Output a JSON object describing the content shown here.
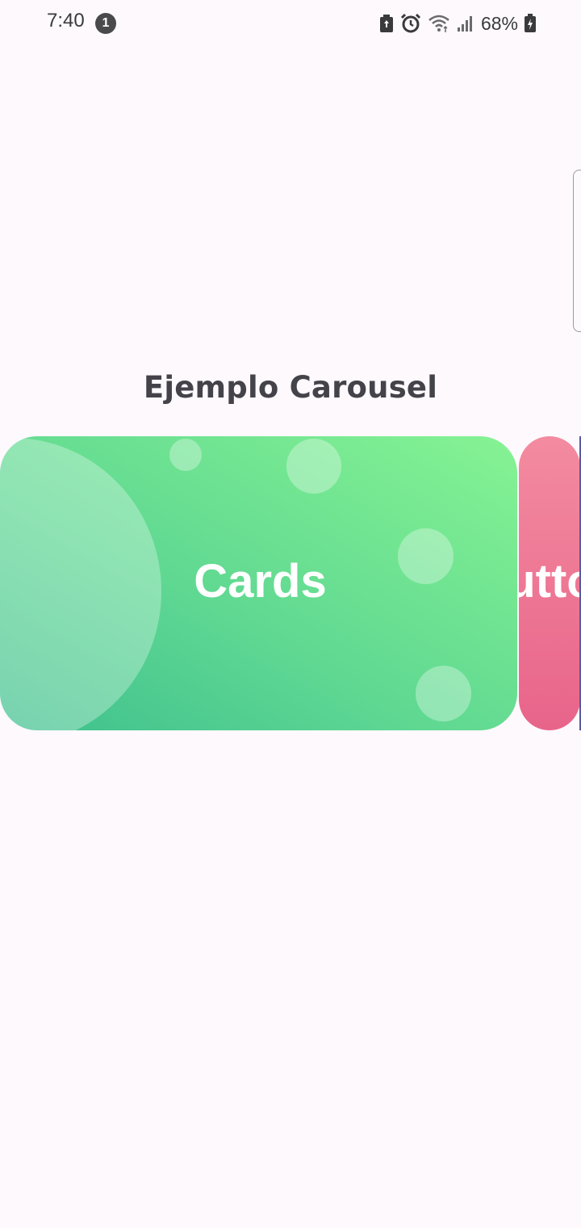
{
  "status_bar": {
    "time": "7:40",
    "notification_count": "1",
    "battery_percent": "68%",
    "icons": [
      "battery-saver-icon",
      "alarm-icon",
      "wifi-icon",
      "signal-icon",
      "battery-charging-icon"
    ]
  },
  "screen": {
    "title": "Ejemplo Carousel"
  },
  "carousel": {
    "items": [
      {
        "label": "Cards",
        "colors": [
          "#3dbf8d",
          "#86f393"
        ]
      },
      {
        "label": "Buttons",
        "visible_text": "utto",
        "colors": [
          "#f38ba0",
          "#e8648a"
        ]
      }
    ]
  }
}
